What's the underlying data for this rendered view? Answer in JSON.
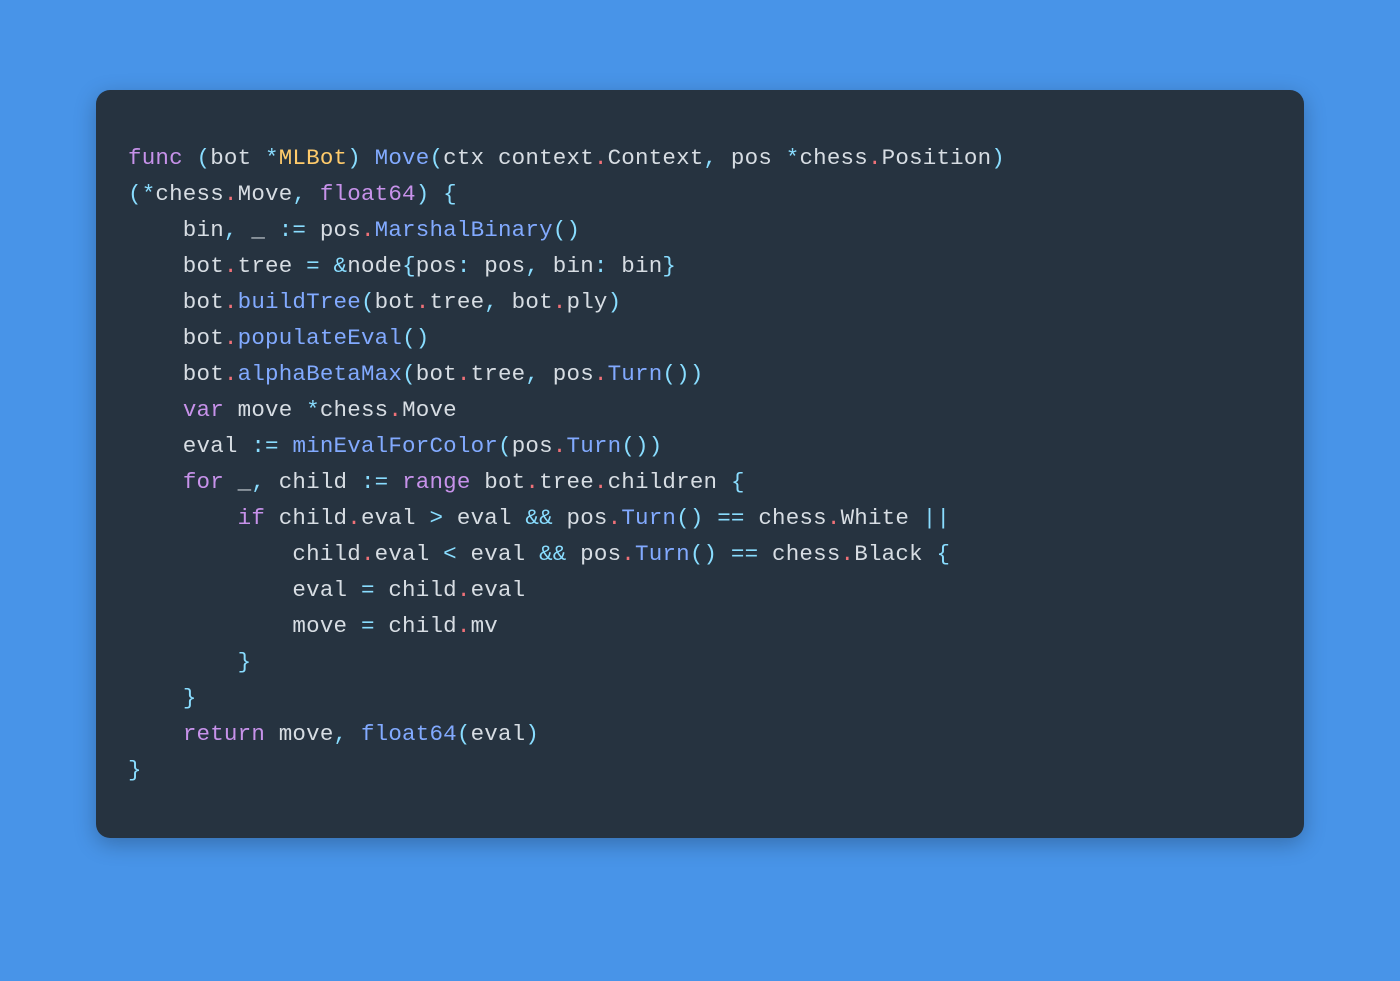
{
  "language": "go",
  "filename_hint": "",
  "theme": {
    "background": "#4894e8",
    "card": "#263340",
    "keyword": "#c792ea",
    "operator": "#89ddff",
    "punct": "#f07178",
    "function": "#82aaff",
    "type": "#ffcb6b",
    "default": "#d7dde3"
  },
  "code": {
    "raw": "func (bot *MLBot) Move(ctx context.Context, pos *chess.Position) \n(*chess.Move, float64) {\n    bin, _ := pos.MarshalBinary()\n    bot.tree = &node{pos: pos, bin: bin}\n    bot.buildTree(bot.tree, bot.ply)\n    bot.populateEval()\n    bot.alphaBetaMax(bot.tree, pos.Turn())\n    var move *chess.Move\n    eval := minEvalForColor(pos.Turn())\n    for _, child := range bot.tree.children {\n        if child.eval > eval && pos.Turn() == chess.White || \n            child.eval < eval && pos.Turn() == chess.Black {\n            eval = child.eval\n            move = child.mv\n        }\n    }\n    return move, float64(eval)\n}",
    "lines": [
      [
        {
          "t": "func ",
          "c": "kw"
        },
        {
          "t": "(",
          "c": "op"
        },
        {
          "t": "bot ",
          "c": "id"
        },
        {
          "t": "*",
          "c": "op"
        },
        {
          "t": "MLBot",
          "c": "ty"
        },
        {
          "t": ")",
          "c": "op"
        },
        {
          "t": " ",
          "c": "id"
        },
        {
          "t": "Move",
          "c": "fn"
        },
        {
          "t": "(",
          "c": "op"
        },
        {
          "t": "ctx context",
          "c": "id"
        },
        {
          "t": ".",
          "c": "pnk"
        },
        {
          "t": "Context",
          "c": "id"
        },
        {
          "t": ",",
          "c": "op"
        },
        {
          "t": " pos ",
          "c": "id"
        },
        {
          "t": "*",
          "c": "op"
        },
        {
          "t": "chess",
          "c": "id"
        },
        {
          "t": ".",
          "c": "pnk"
        },
        {
          "t": "Position",
          "c": "id"
        },
        {
          "t": ")",
          "c": "op"
        },
        {
          "t": " ",
          "c": "id"
        }
      ],
      [
        {
          "t": "(",
          "c": "op"
        },
        {
          "t": "*",
          "c": "op"
        },
        {
          "t": "chess",
          "c": "id"
        },
        {
          "t": ".",
          "c": "pnk"
        },
        {
          "t": "Move",
          "c": "id"
        },
        {
          "t": ",",
          "c": "op"
        },
        {
          "t": " ",
          "c": "id"
        },
        {
          "t": "float64",
          "c": "kw"
        },
        {
          "t": ")",
          "c": "op"
        },
        {
          "t": " ",
          "c": "id"
        },
        {
          "t": "{",
          "c": "op"
        }
      ],
      [
        {
          "t": "    bin",
          "c": "id"
        },
        {
          "t": ",",
          "c": "op"
        },
        {
          "t": " _ ",
          "c": "id"
        },
        {
          "t": ":=",
          "c": "op"
        },
        {
          "t": " pos",
          "c": "id"
        },
        {
          "t": ".",
          "c": "pnk"
        },
        {
          "t": "MarshalBinary",
          "c": "fn"
        },
        {
          "t": "()",
          "c": "op"
        }
      ],
      [
        {
          "t": "    bot",
          "c": "id"
        },
        {
          "t": ".",
          "c": "pnk"
        },
        {
          "t": "tree ",
          "c": "id"
        },
        {
          "t": "=",
          "c": "op"
        },
        {
          "t": " ",
          "c": "id"
        },
        {
          "t": "&",
          "c": "op"
        },
        {
          "t": "node",
          "c": "id"
        },
        {
          "t": "{",
          "c": "op"
        },
        {
          "t": "pos",
          "c": "id"
        },
        {
          "t": ":",
          "c": "op"
        },
        {
          "t": " pos",
          "c": "id"
        },
        {
          "t": ",",
          "c": "op"
        },
        {
          "t": " bin",
          "c": "id"
        },
        {
          "t": ":",
          "c": "op"
        },
        {
          "t": " bin",
          "c": "id"
        },
        {
          "t": "}",
          "c": "op"
        }
      ],
      [
        {
          "t": "    bot",
          "c": "id"
        },
        {
          "t": ".",
          "c": "pnk"
        },
        {
          "t": "buildTree",
          "c": "fn"
        },
        {
          "t": "(",
          "c": "op"
        },
        {
          "t": "bot",
          "c": "id"
        },
        {
          "t": ".",
          "c": "pnk"
        },
        {
          "t": "tree",
          "c": "id"
        },
        {
          "t": ",",
          "c": "op"
        },
        {
          "t": " bot",
          "c": "id"
        },
        {
          "t": ".",
          "c": "pnk"
        },
        {
          "t": "ply",
          "c": "id"
        },
        {
          "t": ")",
          "c": "op"
        }
      ],
      [
        {
          "t": "    bot",
          "c": "id"
        },
        {
          "t": ".",
          "c": "pnk"
        },
        {
          "t": "populateEval",
          "c": "fn"
        },
        {
          "t": "()",
          "c": "op"
        }
      ],
      [
        {
          "t": "    bot",
          "c": "id"
        },
        {
          "t": ".",
          "c": "pnk"
        },
        {
          "t": "alphaBetaMax",
          "c": "fn"
        },
        {
          "t": "(",
          "c": "op"
        },
        {
          "t": "bot",
          "c": "id"
        },
        {
          "t": ".",
          "c": "pnk"
        },
        {
          "t": "tree",
          "c": "id"
        },
        {
          "t": ",",
          "c": "op"
        },
        {
          "t": " pos",
          "c": "id"
        },
        {
          "t": ".",
          "c": "pnk"
        },
        {
          "t": "Turn",
          "c": "fn"
        },
        {
          "t": "())",
          "c": "op"
        }
      ],
      [
        {
          "t": "    ",
          "c": "id"
        },
        {
          "t": "var ",
          "c": "kw"
        },
        {
          "t": "move ",
          "c": "id"
        },
        {
          "t": "*",
          "c": "op"
        },
        {
          "t": "chess",
          "c": "id"
        },
        {
          "t": ".",
          "c": "pnk"
        },
        {
          "t": "Move",
          "c": "id"
        }
      ],
      [
        {
          "t": "    eval ",
          "c": "id"
        },
        {
          "t": ":=",
          "c": "op"
        },
        {
          "t": " ",
          "c": "id"
        },
        {
          "t": "minEvalForColor",
          "c": "fn"
        },
        {
          "t": "(",
          "c": "op"
        },
        {
          "t": "pos",
          "c": "id"
        },
        {
          "t": ".",
          "c": "pnk"
        },
        {
          "t": "Turn",
          "c": "fn"
        },
        {
          "t": "())",
          "c": "op"
        }
      ],
      [
        {
          "t": "    ",
          "c": "id"
        },
        {
          "t": "for ",
          "c": "kw"
        },
        {
          "t": "_",
          "c": "id"
        },
        {
          "t": ",",
          "c": "op"
        },
        {
          "t": " child ",
          "c": "id"
        },
        {
          "t": ":=",
          "c": "op"
        },
        {
          "t": " ",
          "c": "id"
        },
        {
          "t": "range ",
          "c": "kw"
        },
        {
          "t": "bot",
          "c": "id"
        },
        {
          "t": ".",
          "c": "pnk"
        },
        {
          "t": "tree",
          "c": "id"
        },
        {
          "t": ".",
          "c": "pnk"
        },
        {
          "t": "children ",
          "c": "id"
        },
        {
          "t": "{",
          "c": "op"
        }
      ],
      [
        {
          "t": "        ",
          "c": "id"
        },
        {
          "t": "if ",
          "c": "kw"
        },
        {
          "t": "child",
          "c": "id"
        },
        {
          "t": ".",
          "c": "pnk"
        },
        {
          "t": "eval ",
          "c": "id"
        },
        {
          "t": ">",
          "c": "op"
        },
        {
          "t": " eval ",
          "c": "id"
        },
        {
          "t": "&&",
          "c": "op"
        },
        {
          "t": " pos",
          "c": "id"
        },
        {
          "t": ".",
          "c": "pnk"
        },
        {
          "t": "Turn",
          "c": "fn"
        },
        {
          "t": "()",
          "c": "op"
        },
        {
          "t": " ",
          "c": "id"
        },
        {
          "t": "==",
          "c": "op"
        },
        {
          "t": " chess",
          "c": "id"
        },
        {
          "t": ".",
          "c": "pnk"
        },
        {
          "t": "White ",
          "c": "id"
        },
        {
          "t": "||",
          "c": "op"
        },
        {
          "t": " ",
          "c": "id"
        }
      ],
      [
        {
          "t": "            child",
          "c": "id"
        },
        {
          "t": ".",
          "c": "pnk"
        },
        {
          "t": "eval ",
          "c": "id"
        },
        {
          "t": "<",
          "c": "op"
        },
        {
          "t": " eval ",
          "c": "id"
        },
        {
          "t": "&&",
          "c": "op"
        },
        {
          "t": " pos",
          "c": "id"
        },
        {
          "t": ".",
          "c": "pnk"
        },
        {
          "t": "Turn",
          "c": "fn"
        },
        {
          "t": "()",
          "c": "op"
        },
        {
          "t": " ",
          "c": "id"
        },
        {
          "t": "==",
          "c": "op"
        },
        {
          "t": " chess",
          "c": "id"
        },
        {
          "t": ".",
          "c": "pnk"
        },
        {
          "t": "Black ",
          "c": "id"
        },
        {
          "t": "{",
          "c": "op"
        }
      ],
      [
        {
          "t": "            eval ",
          "c": "id"
        },
        {
          "t": "=",
          "c": "op"
        },
        {
          "t": " child",
          "c": "id"
        },
        {
          "t": ".",
          "c": "pnk"
        },
        {
          "t": "eval",
          "c": "id"
        }
      ],
      [
        {
          "t": "            move ",
          "c": "id"
        },
        {
          "t": "=",
          "c": "op"
        },
        {
          "t": " child",
          "c": "id"
        },
        {
          "t": ".",
          "c": "pnk"
        },
        {
          "t": "mv",
          "c": "id"
        }
      ],
      [
        {
          "t": "        ",
          "c": "id"
        },
        {
          "t": "}",
          "c": "op"
        }
      ],
      [
        {
          "t": "    ",
          "c": "id"
        },
        {
          "t": "}",
          "c": "op"
        }
      ],
      [
        {
          "t": "    ",
          "c": "id"
        },
        {
          "t": "return ",
          "c": "kw"
        },
        {
          "t": "move",
          "c": "id"
        },
        {
          "t": ",",
          "c": "op"
        },
        {
          "t": " ",
          "c": "id"
        },
        {
          "t": "float64",
          "c": "fn"
        },
        {
          "t": "(",
          "c": "op"
        },
        {
          "t": "eval",
          "c": "id"
        },
        {
          "t": ")",
          "c": "op"
        }
      ],
      [
        {
          "t": "}",
          "c": "op"
        }
      ]
    ]
  }
}
